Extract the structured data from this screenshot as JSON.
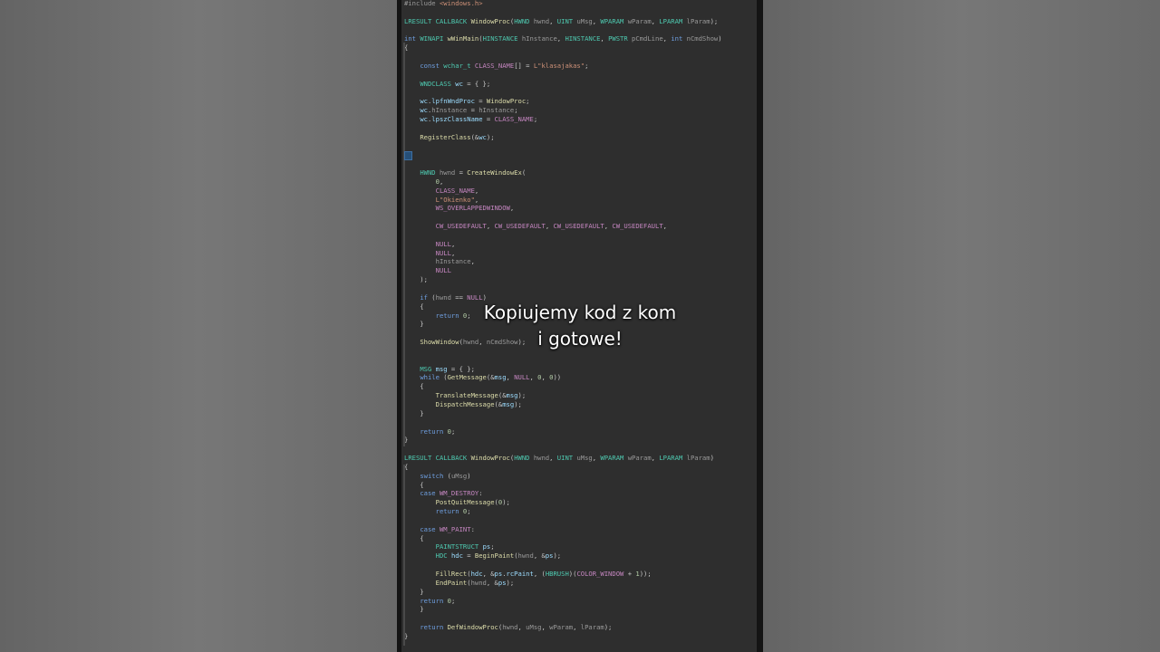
{
  "caption": {
    "line1": "Kopiujemy kod z kom",
    "line2": "i gotowe!"
  },
  "colors": {
    "background": "#6f6f6f",
    "editor_bg": "#2e2e2e",
    "keyword": "#6f9fe0",
    "type": "#4ec9b0",
    "function": "#dcdcaa",
    "string": "#ce9178",
    "caption_text": "#ffffff"
  },
  "code_lines": [
    "#include <windows.h>",
    "",
    "LRESULT CALLBACK WindowProc(HWND hwnd, UINT uMsg, WPARAM wParam, LPARAM lParam);",
    "",
    "int WINAPI wWinMain(HINSTANCE hInstance, HINSTANCE, PWSTR pCmdLine, int nCmdShow)",
    "{",
    "",
    "    const wchar_t CLASS_NAME[] = L\"klasajakas\";",
    "",
    "    WNDCLASS wc = { };",
    "",
    "    wc.lpfnWndProc = WindowProc;",
    "    wc.hInstance = hInstance;",
    "    wc.lpszClassName = CLASS_NAME;",
    "",
    "    RegisterClass(&wc);",
    "",
    "",
    "",
    "    HWND hwnd = CreateWindowEx(",
    "        0,",
    "        CLASS_NAME,",
    "        L\"Okienko\",",
    "        WS_OVERLAPPEDWINDOW,",
    "",
    "        CW_USEDEFAULT, CW_USEDEFAULT, CW_USEDEFAULT, CW_USEDEFAULT,",
    "",
    "        NULL,",
    "        NULL,",
    "        hInstance,",
    "        NULL",
    "    );",
    "",
    "    if (hwnd == NULL)",
    "    {",
    "        return 0;",
    "    }",
    "",
    "    ShowWindow(hwnd, nCmdShow);",
    "",
    "",
    "    MSG msg = { };",
    "    while (GetMessage(&msg, NULL, 0, 0))",
    "    {",
    "        TranslateMessage(&msg);",
    "        DispatchMessage(&msg);",
    "    }",
    "",
    "    return 0;",
    "}",
    "",
    "LRESULT CALLBACK WindowProc(HWND hwnd, UINT uMsg, WPARAM wParam, LPARAM lParam)",
    "{",
    "    switch (uMsg)",
    "    {",
    "    case WM_DESTROY:",
    "        PostQuitMessage(0);",
    "        return 0;",
    "",
    "    case WM_PAINT:",
    "    {",
    "        PAINTSTRUCT ps;",
    "        HDC hdc = BeginPaint(hwnd, &ps);",
    "",
    "        FillRect(hdc, &ps.rcPaint, (HBRUSH)(COLOR_WINDOW + 1));",
    "        EndPaint(hwnd, &ps);",
    "    }",
    "    return 0;",
    "    }",
    "",
    "    return DefWindowProc(hwnd, uMsg, wParam, lParam);",
    "}"
  ]
}
